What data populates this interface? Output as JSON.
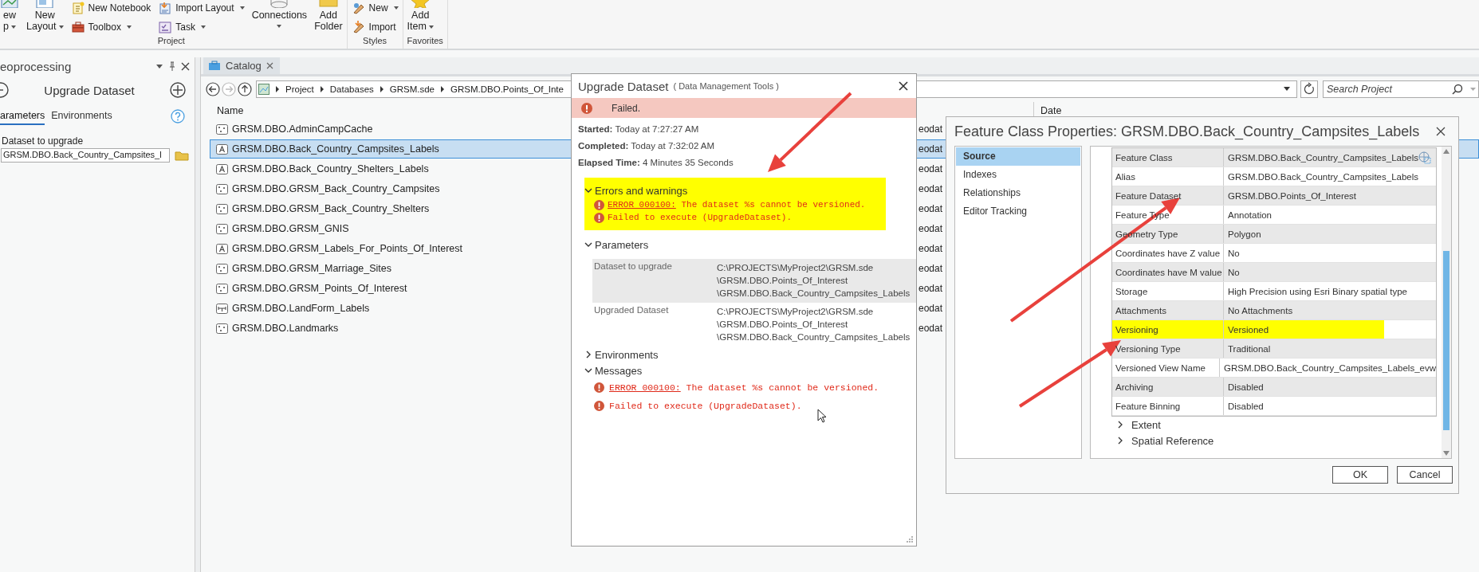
{
  "ribbon": {
    "groups": [
      {
        "label": "Project",
        "columns": [
          {
            "kind": "large",
            "lines": [
              "ew",
              "p"
            ],
            "dropdown": true
          },
          {
            "kind": "large",
            "lines": [
              "New",
              "Layout"
            ],
            "dropdown": true
          },
          {
            "kind": "stack",
            "items": [
              {
                "label": "New Notebook",
                "dropdown": false
              },
              {
                "label": "Toolbox",
                "dropdown": true
              }
            ]
          },
          {
            "kind": "stack",
            "items": [
              {
                "label": "Import Layout",
                "dropdown": true
              },
              {
                "label": "Task",
                "dropdown": true
              }
            ]
          },
          {
            "kind": "large",
            "lines": [
              "Connections"
            ],
            "dropdown": true
          },
          {
            "kind": "large",
            "lines": [
              "Add",
              "Folder"
            ],
            "dropdown": false
          }
        ]
      },
      {
        "label": "Styles",
        "columns": [
          {
            "kind": "stack",
            "items": [
              {
                "label": "New",
                "dropdown": true
              },
              {
                "label": "Import",
                "dropdown": false
              }
            ]
          }
        ]
      },
      {
        "label": "Favorites",
        "columns": [
          {
            "kind": "large",
            "lines": [
              "Add",
              "Item"
            ],
            "dropdown": true
          }
        ]
      }
    ]
  },
  "geoprocessing": {
    "title": "eoprocessing",
    "tool": "Upgrade Dataset",
    "tabs": [
      {
        "label": "arameters",
        "selected": true
      },
      {
        "label": "Environments",
        "selected": false
      }
    ],
    "parameter": {
      "label": "Dataset to upgrade",
      "value": "GRSM.DBO.Back_Country_Campsites_l"
    }
  },
  "catalog": {
    "tab": "Catalog",
    "breadcrumb": [
      "Project",
      "Databases",
      "GRSM.sde",
      "GRSM.DBO.Points_Of_Inte"
    ],
    "search": {
      "placeholder": "Search Project"
    },
    "columns": [
      "Name",
      "Date"
    ],
    "rows": [
      {
        "kind": "point",
        "name": "GRSM.DBO.AdminCampCache",
        "column_2": "eodat",
        "selected": false
      },
      {
        "kind": "annotation",
        "name": "GRSM.DBO.Back_Country_Campsites_Labels",
        "column_2": "eodat",
        "selected": true
      },
      {
        "kind": "annotation",
        "name": "GRSM.DBO.Back_Country_Shelters_Labels",
        "column_2": "eodat",
        "selected": false
      },
      {
        "kind": "point",
        "name": "GRSM.DBO.GRSM_Back_Country_Campsites",
        "column_2": "eodat",
        "selected": false
      },
      {
        "kind": "point",
        "name": "GRSM.DBO.GRSM_Back_Country_Shelters",
        "column_2": "eodat",
        "selected": false
      },
      {
        "kind": "point",
        "name": "GRSM.DBO.GRSM_GNIS",
        "column_2": "eodat",
        "selected": false
      },
      {
        "kind": "annotation",
        "name": "GRSM.DBO.GRSM_Labels_For_Points_Of_Interest",
        "column_2": "eodat",
        "selected": false
      },
      {
        "kind": "point",
        "name": "GRSM.DBO.GRSM_Marriage_Sites",
        "column_2": "eodat",
        "selected": false
      },
      {
        "kind": "point",
        "name": "GRSM.DBO.GRSM_Points_Of_Interest",
        "column_2": "eodat",
        "selected": false
      },
      {
        "kind": "dimension",
        "name": "GRSM.DBO.LandForm_Labels",
        "column_2": "eodat",
        "selected": false
      },
      {
        "kind": "point",
        "name": "GRSM.DBO.Landmarks",
        "column_2": "eodat",
        "selected": false
      }
    ]
  },
  "upgrade_dialog": {
    "title": "Upgrade Dataset",
    "subtitle": "( Data Management Tools )",
    "status": "Failed.",
    "details": [
      "**Started:** Today at 7:27:27 AM",
      "**Completed:** Today at 7:32:02 AM",
      "**Elapsed Time:** 4 Minutes 35 Seconds"
    ],
    "sections": [
      {
        "kind": "messages",
        "title": "Errors and warnings",
        "expanded": true,
        "highlighted": true,
        "messages": [
          {
            "code": "ERROR 000100:",
            "text": " The dataset %s cannot be versioned."
          },
          {
            "text": "Failed to execute (UpgradeDataset)."
          }
        ]
      },
      {
        "kind": "parameters",
        "title": "Parameters",
        "expanded": true,
        "rows": [
          {
            "label": "Dataset to upgrade",
            "value": "C:\\PROJECTS\\MyProject2\\GRSM.sde\n\\GRSM.DBO.Points_Of_Interest\n\\GRSM.DBO.Back_Country_Campsites_Labels"
          },
          {
            "label": "Upgraded Dataset",
            "value": "C:\\PROJECTS\\MyProject2\\GRSM.sde\n\\GRSM.DBO.Points_Of_Interest\n\\GRSM.DBO.Back_Country_Campsites_Labels"
          }
        ]
      },
      {
        "kind": "parameters",
        "title": "Environments",
        "expanded": false
      },
      {
        "kind": "messages",
        "title": "Messages",
        "expanded": true,
        "highlighted": false,
        "messages": [
          {
            "code": "ERROR 000100:",
            "text": " The dataset %s cannot be versioned."
          },
          {
            "text": "Failed to execute (UpgradeDataset)."
          }
        ]
      }
    ]
  },
  "properties_dialog": {
    "title": "Feature Class Properties: GRSM.DBO.Back_Country_Campsites_Labels",
    "pages": [
      {
        "label": "Source",
        "selected": true
      },
      {
        "label": "Indexes",
        "selected": false
      },
      {
        "label": "Relationships",
        "selected": false
      },
      {
        "label": "Editor Tracking",
        "selected": false
      }
    ],
    "properties": [
      {
        "name": "Feature Class",
        "value": "GRSM.DBO.Back_Country_Campsites_Labels",
        "highlighted": false
      },
      {
        "name": "Alias",
        "value": "GRSM.DBO.Back_Country_Campsites_Labels",
        "highlighted": false
      },
      {
        "name": "Feature Dataset",
        "value": "GRSM.DBO.Points_Of_Interest",
        "highlighted": false
      },
      {
        "name": "Feature Type",
        "value": "Annotation",
        "highlighted": false
      },
      {
        "name": "Geometry Type",
        "value": "Polygon",
        "highlighted": false
      },
      {
        "name": "Coordinates have Z value",
        "value": "No",
        "highlighted": false
      },
      {
        "name": "Coordinates have M value",
        "value": "No",
        "highlighted": false
      },
      {
        "name": "Storage",
        "value": "High Precision using Esri Binary spatial type",
        "highlighted": false
      },
      {
        "name": "Attachments",
        "value": "No Attachments",
        "highlighted": false
      },
      {
        "name": "Versioning",
        "value": "Versioned",
        "highlighted": true
      },
      {
        "name": "Versioning Type",
        "value": "Traditional",
        "highlighted": false
      },
      {
        "name": "Versioned View Name",
        "value": "GRSM.DBO.Back_Country_Campsites_Labels_evw",
        "highlighted": false
      },
      {
        "name": "Archiving",
        "value": "Disabled",
        "highlighted": false
      },
      {
        "name": "Feature Binning",
        "value": "Disabled",
        "highlighted": false
      }
    ],
    "sections": [
      {
        "title": "Extent",
        "expanded": false
      },
      {
        "title": "Spatial Reference",
        "expanded": false
      }
    ],
    "buttons": [
      "OK",
      "Cancel"
    ]
  }
}
